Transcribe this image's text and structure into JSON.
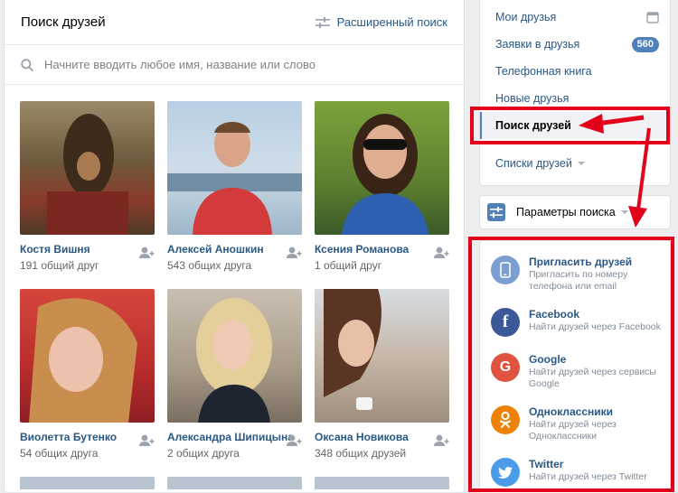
{
  "main": {
    "title": "Поиск друзей",
    "advanced_search": "Расширенный поиск",
    "search_placeholder": "Начните вводить любое имя, название или слово"
  },
  "people": [
    {
      "name": "Костя Вишня",
      "mutual": "191 общий друг"
    },
    {
      "name": "Алексей Аношкин",
      "mutual": "543 общих друга"
    },
    {
      "name": "Ксения Романова",
      "mutual": "1 общий друг"
    },
    {
      "name": "Виолетта Бутенко",
      "mutual": "54 общих друга"
    },
    {
      "name": "Александра Шипицына",
      "mutual": "2 общих друга"
    },
    {
      "name": "Оксана Новикова",
      "mutual": "348 общих друзей"
    }
  ],
  "menu": {
    "items": [
      {
        "label": "Мои друзья"
      },
      {
        "label": "Заявки в друзья",
        "badge": "560"
      },
      {
        "label": "Телефонная книга"
      },
      {
        "label": "Новые друзья"
      },
      {
        "label": "Поиск друзей"
      },
      {
        "label": "Списки друзей"
      }
    ]
  },
  "params_label": "Параметры поиска",
  "invite": [
    {
      "title": "Пригласить друзей",
      "line1": "Пригласить по номеру",
      "line2": "телефона или email",
      "color": "#7b9fd0"
    },
    {
      "title": "Facebook",
      "line1": "Найти друзей через Facebook",
      "line2": "",
      "color": "#3b5998"
    },
    {
      "title": "Google",
      "line1": "Найти друзей через сервисы",
      "line2": "Google",
      "color": "#e0533f"
    },
    {
      "title": "Одноклассники",
      "line1": "Найти друзей через",
      "line2": "Одноклассники",
      "color": "#ee8208"
    },
    {
      "title": "Twitter",
      "line1": "Найти друзей через Twitter",
      "line2": "",
      "color": "#4a9ce9"
    }
  ],
  "colors": {
    "link": "#2a5885",
    "accent": "#5181b8",
    "annotation": "#e3001b"
  }
}
